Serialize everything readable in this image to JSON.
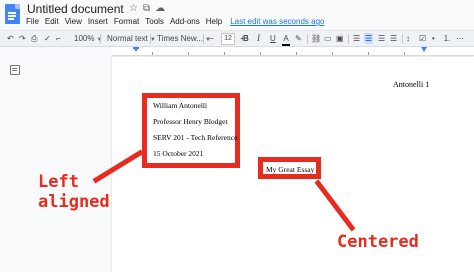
{
  "document": {
    "title": "Untitled document",
    "menu": [
      "File",
      "Edit",
      "View",
      "Insert",
      "Format",
      "Tools",
      "Add-ons",
      "Help"
    ],
    "last_edit": "Last edit was seconds ago"
  },
  "toolbar": {
    "zoom": "100%",
    "style": "Normal text",
    "font": "Times New...",
    "minus": "−",
    "font_size": "12",
    "plus": "+",
    "bold": "B",
    "italic": "I",
    "underline": "U",
    "text_color": "A"
  },
  "page": {
    "header": "Antonelli 1",
    "heading_lines": [
      "William Antonelli",
      "Professor Henry Blodget",
      "SERV 201 - Tech Reference",
      "15 October 2021"
    ],
    "essay_title": "My Great Essay"
  },
  "annotations": {
    "left_aligned": [
      "Left",
      "aligned"
    ],
    "centered": "Centered",
    "color": "#e62c1f"
  },
  "colors": {
    "accent": "#1a73e8",
    "doc_icon": "#4285f4"
  }
}
